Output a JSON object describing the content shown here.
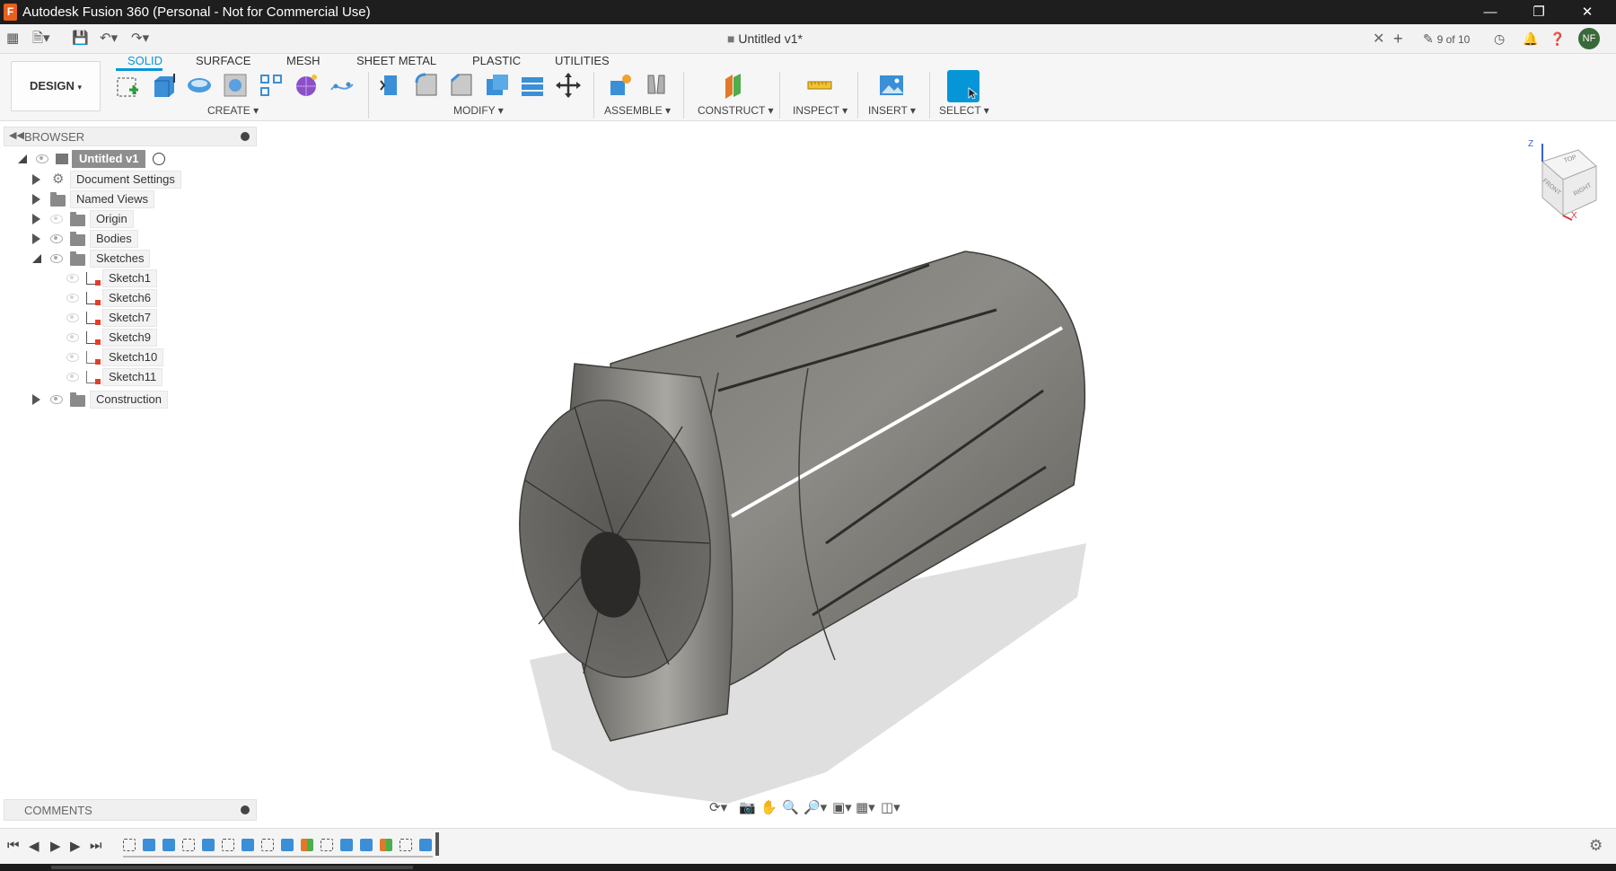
{
  "window": {
    "title": "Autodesk Fusion 360 (Personal - Not for Commercial Use)",
    "app_icon_letter": "F",
    "controls": [
      "minimize-icon",
      "restore-icon",
      "close-icon"
    ]
  },
  "tabbar": {
    "doc_title": "Untitled v1*",
    "doc_count": "9 of 10",
    "user_initials": "NF"
  },
  "ribbon": {
    "workspace": "DESIGN",
    "tabs": [
      "SOLID",
      "SURFACE",
      "MESH",
      "SHEET METAL",
      "PLASTIC",
      "UTILITIES"
    ],
    "active_tab": "SOLID",
    "groups": [
      "CREATE",
      "MODIFY",
      "ASSEMBLE",
      "CONSTRUCT",
      "INSPECT",
      "INSERT",
      "SELECT"
    ],
    "accent": "#0696d7"
  },
  "browser": {
    "header": "BROWSER",
    "root": "Untitled v1",
    "items": [
      "Document Settings",
      "Named Views",
      "Origin",
      "Bodies",
      "Sketches",
      "Construction"
    ],
    "sketches": [
      "Sketch1",
      "Sketch6",
      "Sketch7",
      "Sketch9",
      "Sketch10",
      "Sketch11"
    ]
  },
  "comments": {
    "label": "COMMENTS"
  },
  "viewcube": {
    "faces": [
      "TOP",
      "FRONT",
      "RIGHT"
    ],
    "axes": [
      "Z",
      "X"
    ]
  }
}
